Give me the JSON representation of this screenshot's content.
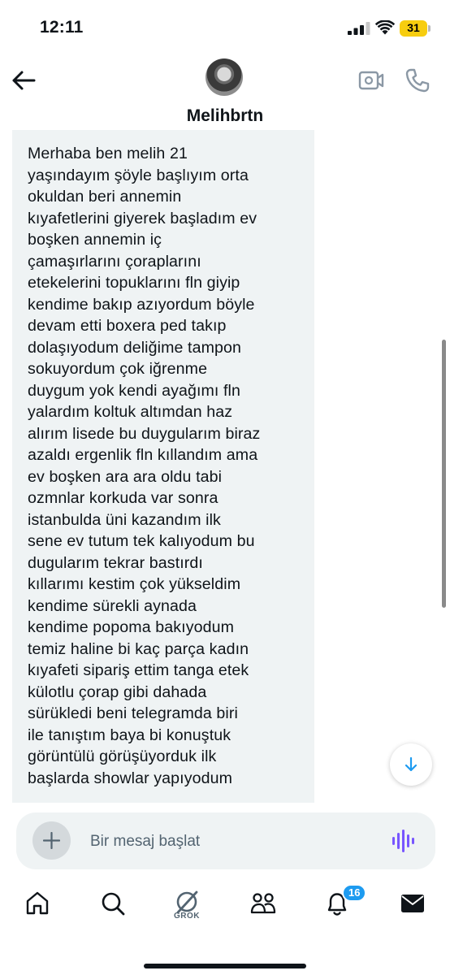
{
  "status_bar": {
    "time": "12:11",
    "battery": "31",
    "battery_color": "#f7cd0f"
  },
  "header": {
    "contact_name": "Melihbrtn",
    "back_icon": "arrow-left-icon",
    "video_icon": "video-camera-icon",
    "call_icon": "phone-icon"
  },
  "conversation": {
    "message_text": "Merhaba ben melih 21\nyaşındayım şöyle başlıyım orta\nokuldan beri annemin\nkıyafetlerini giyerek başladım ev\nboşken annemin iç\nçamaşırlarını çoraplarını\netekelerini topuklarını fln giyip\nkendime bakıp azıyordum böyle\ndevam etti boxera ped takıp\ndolaşıyodum deliğime tampon\nsokuyordum çok iğrenme\nduygum yok kendi ayağımı fln\nyalardım koltuk altımdan haz\nalırım lisede bu duygularım biraz\nazaldı ergenlik fln kıllandım ama\nev boşken ara ara oldu tabi\nozmnlar korkuda var sonra\nistanbulda üni kazandım ilk\nsene ev tutum tek kalıyodum bu\ndugularım tekrar bastırdı\nkıllarımı kestim çok yükseldim\nkendime sürekli aynada\nkendime popoma bakıyodum\ntemiz haline bi kaç parça kadın\nkıyafeti sipariş ettim tanga etek\nkülotlu çorap gibi dahada\nsürükledi beni telegramda biri\nile tanıştım baya bi konuştuk\ngörüntülü görüşüyorduk ilk\nbaşlarda showlar yapıyodum",
    "bubble_color": "#eff3f4",
    "scroll_down_icon": "arrow-down-icon"
  },
  "composer": {
    "placeholder": "Bir mesaj başlat",
    "add_icon": "plus-icon",
    "voice_icon": "voice-waveform-icon",
    "voice_color": "#7856ff"
  },
  "bottom_nav": {
    "items": [
      {
        "icon": "home-icon"
      },
      {
        "icon": "search-icon"
      },
      {
        "icon": "grok-icon",
        "label": "GROK"
      },
      {
        "icon": "communities-icon"
      },
      {
        "icon": "notifications-bell-icon",
        "badge": "16"
      },
      {
        "icon": "messages-envelope-icon"
      }
    ],
    "accent_color": "#1d9bf0"
  }
}
